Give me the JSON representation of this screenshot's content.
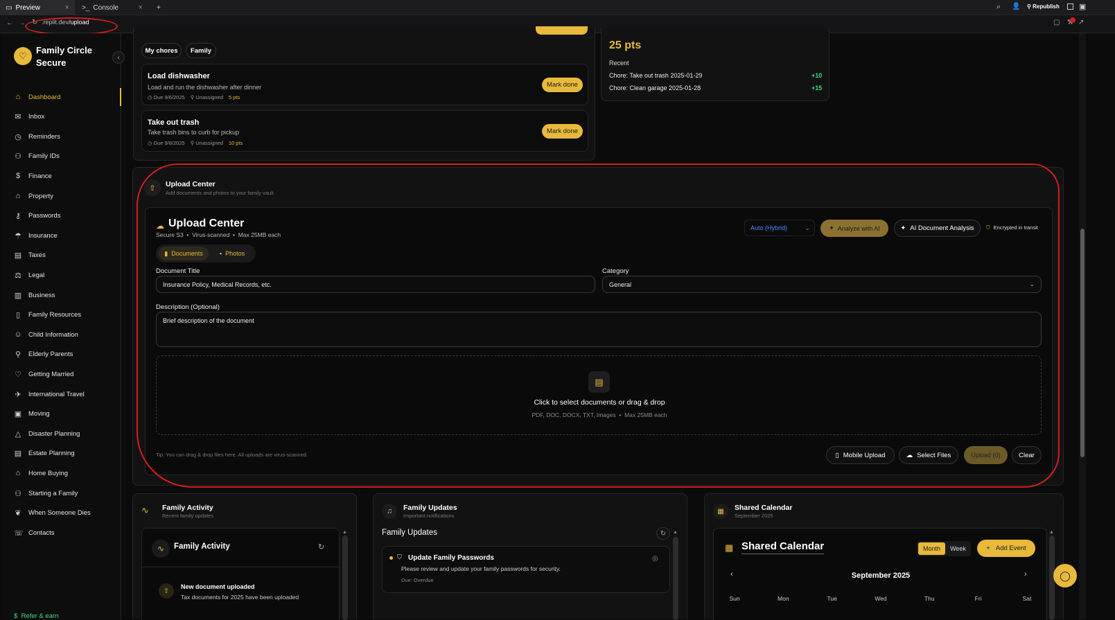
{
  "browser": {
    "tabs": [
      {
        "label": "Preview"
      },
      {
        "label": "Console"
      }
    ],
    "url_prefix": ".replit.dev",
    "url_path": "/upload",
    "republish": "Republish"
  },
  "sidebar": {
    "brand": "Family Circle Secure",
    "items": [
      {
        "label": "Dashboard",
        "icon": "home-icon"
      },
      {
        "label": "Inbox",
        "icon": "inbox-icon"
      },
      {
        "label": "Reminders",
        "icon": "clock-icon"
      },
      {
        "label": "Family IDs",
        "icon": "users-icon"
      },
      {
        "label": "Finance",
        "icon": "dollar-icon"
      },
      {
        "label": "Property",
        "icon": "house-icon"
      },
      {
        "label": "Passwords",
        "icon": "key-icon"
      },
      {
        "label": "Insurance",
        "icon": "umbrella-icon"
      },
      {
        "label": "Taxes",
        "icon": "receipt-icon"
      },
      {
        "label": "Legal",
        "icon": "scale-icon"
      },
      {
        "label": "Business",
        "icon": "building-icon"
      },
      {
        "label": "Family Resources",
        "icon": "book-icon"
      },
      {
        "label": "Child Information",
        "icon": "child-icon"
      },
      {
        "label": "Elderly Parents",
        "icon": "person-icon"
      },
      {
        "label": "Getting Married",
        "icon": "heart-icon"
      },
      {
        "label": "International Travel",
        "icon": "plane-icon"
      },
      {
        "label": "Moving",
        "icon": "box-icon"
      },
      {
        "label": "Disaster Planning",
        "icon": "alert-icon"
      },
      {
        "label": "Estate Planning",
        "icon": "document-icon"
      },
      {
        "label": "Home Buying",
        "icon": "home-icon"
      },
      {
        "label": "Starting a Family",
        "icon": "family-icon"
      },
      {
        "label": "When Someone Dies",
        "icon": "leaf-icon"
      },
      {
        "label": "Contacts",
        "icon": "phone-icon"
      }
    ],
    "refer": "Refer & earn"
  },
  "chores": {
    "tabs": [
      "My chores",
      "Family"
    ],
    "items": [
      {
        "title": "Load dishwasher",
        "desc": "Load and run the dishwasher after dinner",
        "due": "Due 9/6/2025",
        "assignee": "Unassigned",
        "points": "5 pts",
        "action": "Mark done"
      },
      {
        "title": "Take out trash",
        "desc": "Take trash bins to curb for pickup",
        "due": "Due 9/8/2025",
        "assignee": "Unassigned",
        "points": "10 pts",
        "action": "Mark done"
      }
    ]
  },
  "points": {
    "total": "25 pts",
    "recent_label": "Recent",
    "recent": [
      {
        "label": "Chore: Take out trash 2025-01-29",
        "value": "+10"
      },
      {
        "label": "Chore: Clean garage 2025-01-28",
        "value": "+15"
      }
    ]
  },
  "upload": {
    "section_title": "Upload Center",
    "section_sub": "Add documents and photos to your family vault",
    "title": "Upload Center",
    "meta": "Secure S3  •  Virus-scanned  •  Max 25MB each",
    "mode": "Auto (Hybrid)",
    "analyze": "Analyze with AI",
    "doc_analysis": "AI Document Analysis",
    "encrypted": "Encrypted in transit",
    "tabs": [
      "Documents",
      "Photos"
    ],
    "doc_title_label": "Document Title",
    "doc_title_placeholder": "Insurance Policy, Medical Records, etc.",
    "category_label": "Category",
    "category_value": "General",
    "desc_label": "Description (Optional)",
    "desc_placeholder": "Brief description of the document",
    "drop_title": "Click to select documents or drag & drop",
    "drop_sub": "PDF, DOC, DOCX, TXT, Images  •  Max 25MB each",
    "tip": "Tip: You can drag & drop files here. All uploads are virus-scanned.",
    "mobile": "Mobile Upload",
    "select": "Select Files",
    "upload": "Upload (0)",
    "clear": "Clear"
  },
  "activity": {
    "title": "Family Activity",
    "sub": "Recent family updates",
    "inner_title": "Family Activity",
    "item_title": "New document uploaded",
    "item_desc": "Tax documents for 2025 have been uploaded"
  },
  "updates": {
    "title": "Family Updates",
    "sub": "Important notifications",
    "inner_title": "Family Updates",
    "item_title": "Update Family Passwords",
    "item_desc": "Please review and update your family passwords for security.",
    "item_due": "Due: Overdue"
  },
  "calendar": {
    "title": "Shared Calendar",
    "sub": "September 2025",
    "inner_title": "Shared Calendar",
    "views": [
      "Month",
      "Week"
    ],
    "add": "Add Event",
    "month": "September 2025",
    "days": [
      "Sun",
      "Mon",
      "Tue",
      "Wed",
      "Thu",
      "Fri",
      "Sat"
    ]
  },
  "colors": {
    "accent": "#e8b93a",
    "positive": "#3ddc84",
    "annotation": "#d41e1e"
  }
}
